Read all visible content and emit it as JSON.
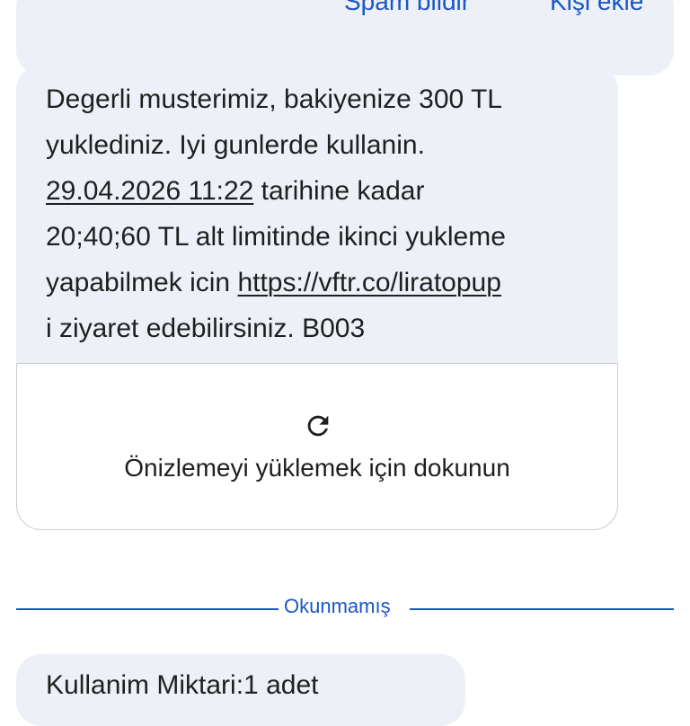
{
  "actions": {
    "spam_label": "Spam bildir",
    "add_contact_label": "Kişi ekle"
  },
  "message": {
    "line1": "Degerli musterimiz, bakiyenize 300 TL",
    "line2": "yuklediniz. Iyi gunlerde kullanin.",
    "line3_date": "29.04.2026 11:22",
    "line3_rest": " tarihine kadar",
    "line4": "20;40;60 TL alt limitinde ikinci yukleme",
    "line5_pre": "yapabilmek icin ",
    "line5_link": "https://vftr.co/liratopup",
    "line6": "i ziyaret edebilirsiniz. B003"
  },
  "preview": {
    "label": "Önizlemeyi yüklemek için dokunun",
    "icon": "reload-icon"
  },
  "divider": {
    "label": "Okunmamış"
  },
  "next_message": {
    "text": "Kullanim Miktari:1 adet"
  },
  "colors": {
    "accent": "#1a56c4",
    "bubble": "#edf1f7",
    "text": "#1f1f1f"
  }
}
